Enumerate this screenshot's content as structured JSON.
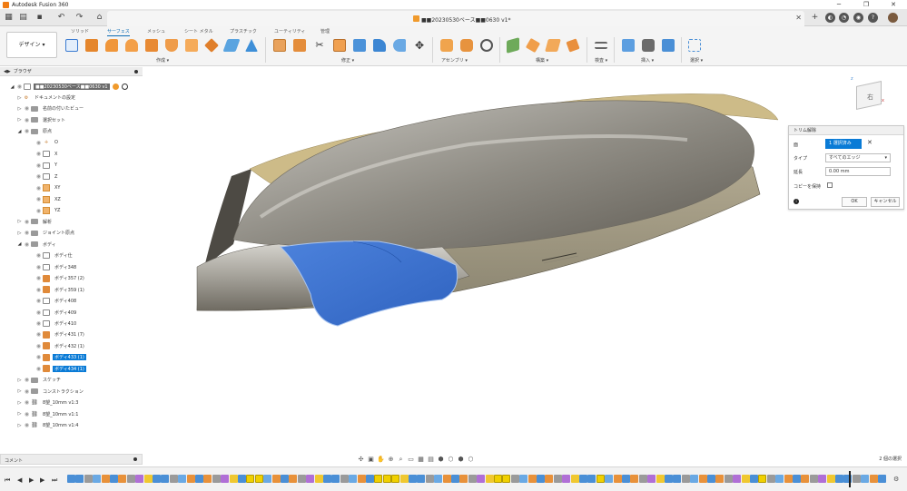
{
  "app": {
    "title": "Autodesk Fusion 360"
  },
  "window_controls": [
    "─",
    "❐",
    "✕"
  ],
  "document": {
    "title": "■■20230530ベース■■0630 v1*"
  },
  "ribbon": {
    "workspace": "デザイン ▾",
    "tabs": [
      "ソリッド",
      "サーフェス",
      "メッシュ",
      "シート メタル",
      "プラスチック",
      "ユーティリティ",
      "管理"
    ],
    "active_tab": "サーフェス",
    "groups": [
      "作成 ▾",
      "修正 ▾",
      "アセンブリ ▾",
      "構築 ▾",
      "検査 ▾",
      "挿入 ▾",
      "選択 ▾"
    ]
  },
  "browser": {
    "title": "ブラウザ",
    "root": "■■20230530ベース■■0630 v1",
    "items": [
      {
        "label": "ドキュメントの設定",
        "kind": "gear",
        "level": 1
      },
      {
        "label": "名前の付いたビュー",
        "kind": "folder",
        "level": 1
      },
      {
        "label": "選択セット",
        "kind": "folder",
        "level": 1
      },
      {
        "label": "原点",
        "kind": "folder",
        "level": 1
      },
      {
        "label": "O",
        "kind": "axis",
        "level": 2
      },
      {
        "label": "X",
        "kind": "box",
        "level": 2
      },
      {
        "label": "Y",
        "kind": "box",
        "level": 2
      },
      {
        "label": "Z",
        "kind": "box",
        "level": 2
      },
      {
        "label": "XY",
        "kind": "plane",
        "level": 2
      },
      {
        "label": "XZ",
        "kind": "plane",
        "level": 2
      },
      {
        "label": "YZ",
        "kind": "plane",
        "level": 2
      },
      {
        "label": "解析",
        "kind": "folder",
        "level": 1
      },
      {
        "label": "ジョイント原点",
        "kind": "folder",
        "level": 1
      },
      {
        "label": "ボディ",
        "kind": "folder",
        "level": 1
      },
      {
        "label": "ボディ仕",
        "kind": "box",
        "level": 2
      },
      {
        "label": "ボディ348",
        "kind": "box",
        "level": 2
      },
      {
        "label": "ボディ357 (2)",
        "kind": "obox",
        "level": 2
      },
      {
        "label": "ボディ359 (1)",
        "kind": "obox",
        "level": 2
      },
      {
        "label": "ボディ408",
        "kind": "box",
        "level": 2
      },
      {
        "label": "ボディ409",
        "kind": "box",
        "level": 2
      },
      {
        "label": "ボディ410",
        "kind": "box",
        "level": 2
      },
      {
        "label": "ボディ431 (7)",
        "kind": "obox",
        "level": 2
      },
      {
        "label": "ボディ432 (1)",
        "kind": "obox",
        "level": 2
      },
      {
        "label": "ボディ433 (1)",
        "kind": "obox",
        "level": 2,
        "selected": true
      },
      {
        "label": "ボディ434 (1)",
        "kind": "obox",
        "level": 2,
        "selected": true
      },
      {
        "label": "スケッチ",
        "kind": "folder",
        "level": 1
      },
      {
        "label": "コンストラクション",
        "kind": "folder",
        "level": 1
      },
      {
        "label": "8望_10mm v1:3",
        "kind": "chain",
        "level": 1
      },
      {
        "label": "8望_10mm v1:1",
        "kind": "chain",
        "level": 1
      },
      {
        "label": "8望_10mm v1:4",
        "kind": "chain",
        "level": 1
      }
    ]
  },
  "comments": {
    "label": "コメント"
  },
  "trim_dialog": {
    "title": "トリム解除",
    "face_label": "面",
    "selection_button": "1 選択済み",
    "type_label": "タイプ",
    "type_value": "すべてのエッジ",
    "extend_label": "延長",
    "extend_value": "0.00 mm",
    "keep_copy_label": "コピーを保持",
    "ok_label": "OK",
    "cancel_label": "キャンセル"
  },
  "viewcube": {
    "face_label": "右"
  },
  "status": {
    "text": "2 個の選択"
  },
  "colors": {
    "accent": "#0a7bd6",
    "selection_blue": "#3a6fcf",
    "body_gray": "#8d8a82",
    "body_tan": "#cdbb88"
  }
}
